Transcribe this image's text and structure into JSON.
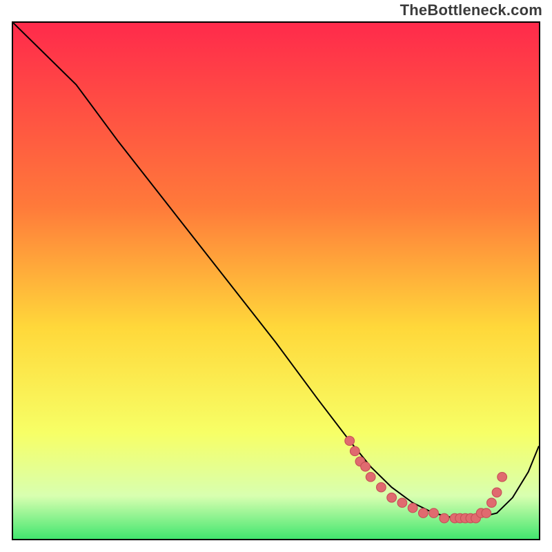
{
  "watermark": "TheBottleneck.com",
  "colors": {
    "top": "#ff2a4b",
    "upper_mid": "#ff7a3a",
    "mid": "#ffd83a",
    "lower_mid": "#f7ff66",
    "pale_green": "#d8ffb0",
    "green": "#20e060",
    "curve_stroke": "#000000",
    "marker_fill": "#e06a6f",
    "marker_stroke": "#c65057"
  },
  "chart_data": {
    "type": "line",
    "title": "",
    "xlabel": "",
    "ylabel": "",
    "xlim": [
      0,
      100
    ],
    "ylim": [
      0,
      100
    ],
    "gradient_axis": "y",
    "gradient_stops": [
      {
        "pos": 0,
        "color": "#ff2a4b"
      },
      {
        "pos": 35,
        "color": "#ff7a3a"
      },
      {
        "pos": 58,
        "color": "#ffd83a"
      },
      {
        "pos": 78,
        "color": "#f7ff66"
      },
      {
        "pos": 90,
        "color": "#d8ffb0"
      },
      {
        "pos": 100,
        "color": "#20e060"
      }
    ],
    "series": [
      {
        "name": "bottleneck-curve",
        "x": [
          0,
          6,
          12,
          20,
          30,
          40,
          50,
          58,
          64,
          68,
          72,
          76,
          80,
          84,
          88,
          92,
          95,
          98,
          100
        ],
        "y": [
          100,
          94,
          88,
          77,
          64,
          51,
          38,
          27,
          19,
          14,
          10,
          7,
          5,
          4,
          4,
          5,
          8,
          13,
          18
        ]
      }
    ],
    "markers": {
      "name": "highlight-dots",
      "x": [
        64,
        65,
        66,
        67,
        68,
        70,
        72,
        74,
        76,
        78,
        80,
        82,
        84,
        85,
        86,
        87,
        88,
        89,
        90,
        91,
        92,
        93
      ],
      "y": [
        19,
        17,
        15,
        14,
        12,
        10,
        8,
        7,
        6,
        5,
        5,
        4,
        4,
        4,
        4,
        4,
        4,
        5,
        5,
        7,
        9,
        12
      ],
      "r": 5
    }
  }
}
